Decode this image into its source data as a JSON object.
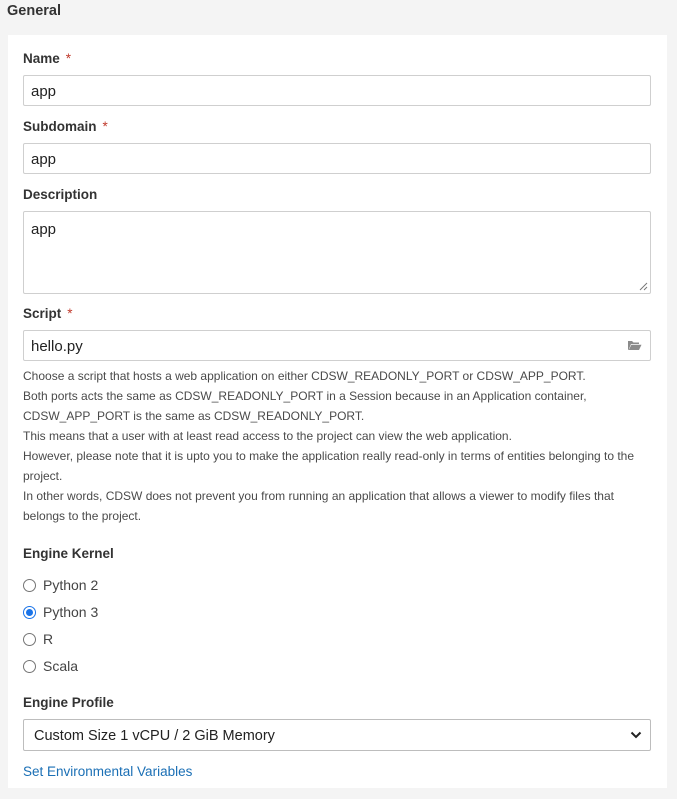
{
  "section": {
    "title": "General"
  },
  "form": {
    "name": {
      "label": "Name",
      "required_mark": "*",
      "value": "app"
    },
    "subdomain": {
      "label": "Subdomain",
      "required_mark": "*",
      "value": "app"
    },
    "description": {
      "label": "Description",
      "value": "app"
    },
    "script": {
      "label": "Script",
      "required_mark": "*",
      "value": "hello.py",
      "icon": "folder-open-icon"
    },
    "help_lines": [
      "Choose a script that hosts a web application on either CDSW_READONLY_PORT or CDSW_APP_PORT.",
      "Both ports acts the same as CDSW_READONLY_PORT in a Session because in an Application container, CDSW_APP_PORT is the same as CDSW_READONLY_PORT.",
      "This means that a user with at least read access to the project can view the web application.",
      "However, please note that it is upto you to make the application really read-only in terms of entities belonging to the project.",
      "In other words, CDSW does not prevent you from running an application that allows a viewer to modify files that belongs to the project."
    ],
    "engine_kernel": {
      "label": "Engine Kernel",
      "options": [
        "Python 2",
        "Python 3",
        "R",
        "Scala"
      ],
      "selected": "Python 3"
    },
    "engine_profile": {
      "label": "Engine Profile",
      "selected": "Custom Size 1 vCPU / 2 GiB Memory"
    },
    "env_link": "Set Environmental Variables"
  },
  "colors": {
    "accent": "#1a73e8",
    "link": "#1a6fb5",
    "required": "#c0392b"
  }
}
